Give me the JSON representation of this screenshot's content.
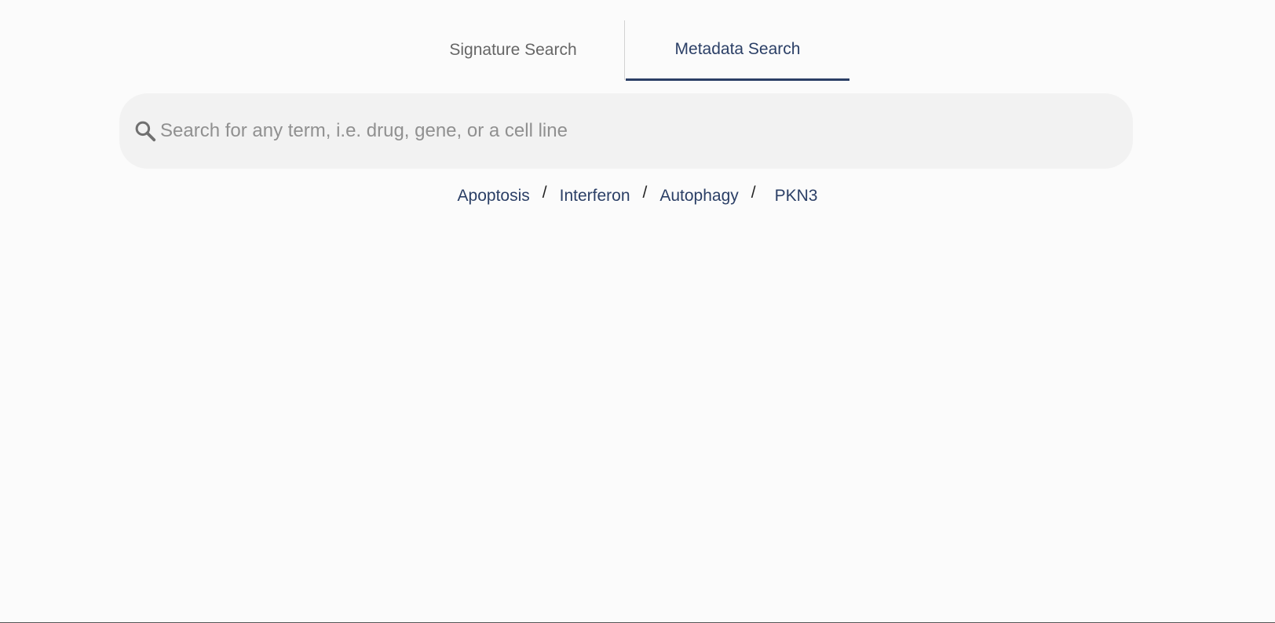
{
  "tabs": [
    {
      "label": "Signature Search",
      "active": false
    },
    {
      "label": "Metadata Search",
      "active": true
    }
  ],
  "search": {
    "placeholder": "Search for any term, i.e. drug, gene, or a cell line",
    "value": "",
    "icon": "search-icon"
  },
  "suggestions": {
    "items": [
      "Apoptosis",
      "Interferon",
      "Autophagy",
      "PKN3"
    ],
    "separator": "/"
  },
  "colors": {
    "accent": "#2b3f66",
    "inactive_tab": "#666666",
    "search_bg": "#f2f2f2",
    "background": "#fbfbfb"
  }
}
